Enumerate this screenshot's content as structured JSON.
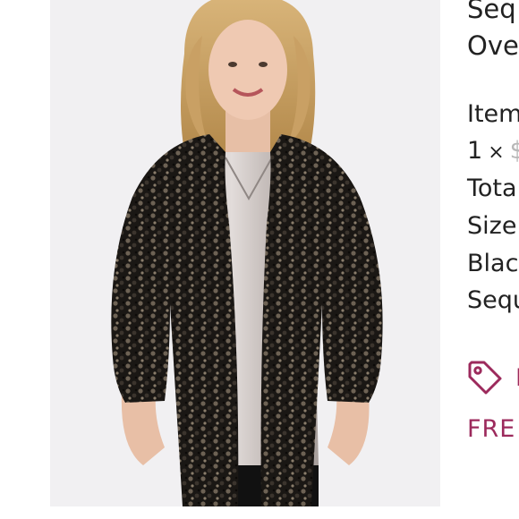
{
  "product": {
    "title_line1": "Seq",
    "title_line2": "Ove",
    "image_alt": "Woman wearing black sequin open kimono over a silver satin camisole"
  },
  "details": {
    "item_label": "Item",
    "qty": "1",
    "qty_separator": "×",
    "price_partial": "$",
    "total_label": "Tota",
    "size_label": "Size",
    "color_partial": "Blac",
    "style_partial": "Sequ"
  },
  "promo": {
    "tag_icon": "tag-icon",
    "tag_text": "L",
    "shipping_text": "FRE"
  },
  "colors": {
    "accent": "#9c2a5c",
    "text": "#222222",
    "strike": "#b8b8b8"
  }
}
